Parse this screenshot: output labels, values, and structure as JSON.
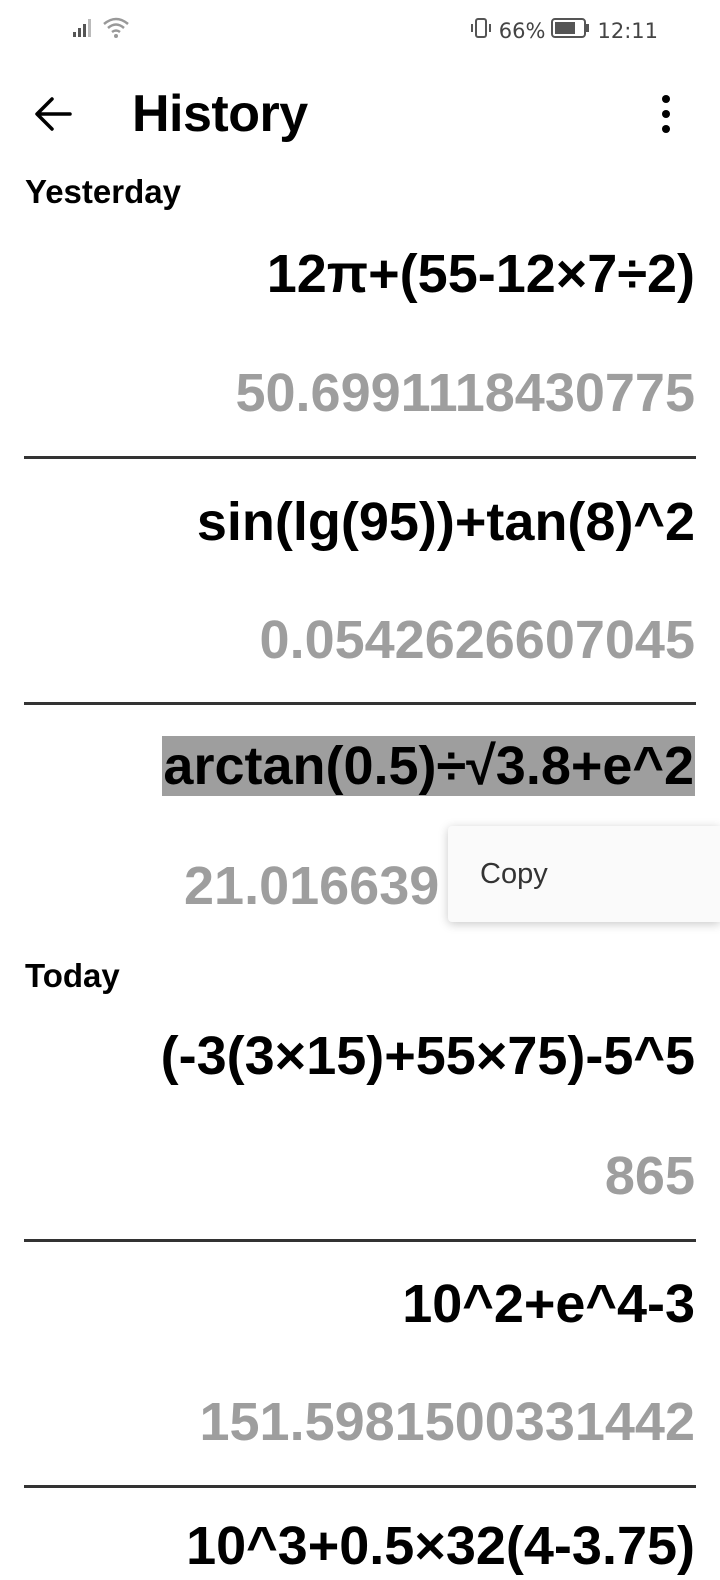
{
  "status_bar": {
    "battery_percent": "66%",
    "time": "12:11"
  },
  "app_bar": {
    "title": "History"
  },
  "sections": [
    {
      "label": "Yesterday",
      "entries": [
        {
          "expression": "12π+(55-12×7÷2)",
          "result": "50.6991118430775"
        },
        {
          "expression": "sin(lg(95))+tan(8)^2",
          "result": "0.0542626607045"
        },
        {
          "expression": "arctan(0.5)÷√3.8+e^2",
          "result": "21.016639"
        }
      ]
    },
    {
      "label": "Today",
      "entries": [
        {
          "expression": "(-3(3×15)+55×75)-5^5",
          "result": "865"
        },
        {
          "expression": "10^2+e^4-3",
          "result": "151.5981500331442"
        },
        {
          "expression": "10^3+0.5×32(4-3.75)",
          "result": ""
        }
      ]
    }
  ],
  "popup": {
    "copy_label": "Copy"
  }
}
